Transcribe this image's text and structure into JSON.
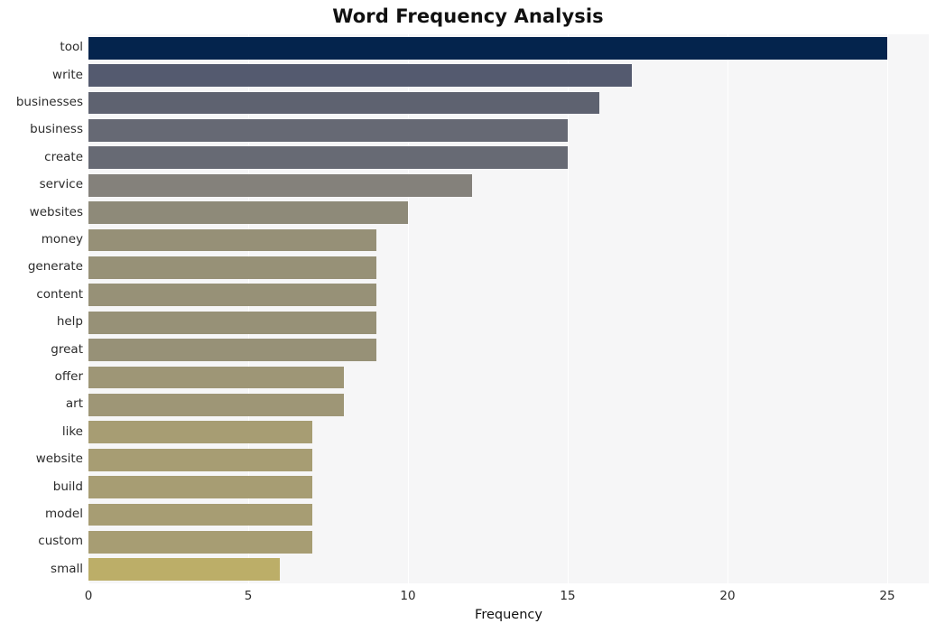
{
  "chart_data": {
    "type": "bar",
    "orientation": "horizontal",
    "title": "Word Frequency Analysis",
    "xlabel": "Frequency",
    "ylabel": "",
    "xlim": [
      0,
      26.3
    ],
    "ylim": [
      0,
      20
    ],
    "grid": true,
    "legend": null,
    "xticks": [
      0,
      5,
      10,
      15,
      20,
      25
    ],
    "xtick_labels": [
      "0",
      "5",
      "10",
      "15",
      "20",
      "25"
    ],
    "categories": [
      "tool",
      "write",
      "businesses",
      "business",
      "create",
      "service",
      "websites",
      "money",
      "generate",
      "content",
      "help",
      "great",
      "offer",
      "art",
      "like",
      "website",
      "build",
      "model",
      "custom",
      "small"
    ],
    "values": [
      25,
      17,
      16,
      15,
      15,
      12,
      10,
      9,
      9,
      9,
      9,
      9,
      8,
      8,
      7,
      7,
      7,
      7,
      7,
      6
    ],
    "bar_colors": [
      "#04244d",
      "#545a6f",
      "#5e6270",
      "#666974",
      "#676a74",
      "#84817b",
      "#8e8a79",
      "#969077",
      "#979177",
      "#979177",
      "#979177",
      "#979177",
      "#9e9676",
      "#9e9676",
      "#a79d73",
      "#a79d73",
      "#a79d73",
      "#a79d73",
      "#a79d73",
      "#bcae68"
    ],
    "plot_background": "#f6f6f7",
    "grid_color": "#ffffff",
    "figure_background": "#ffffff",
    "text_color": "#2b2b2b"
  }
}
